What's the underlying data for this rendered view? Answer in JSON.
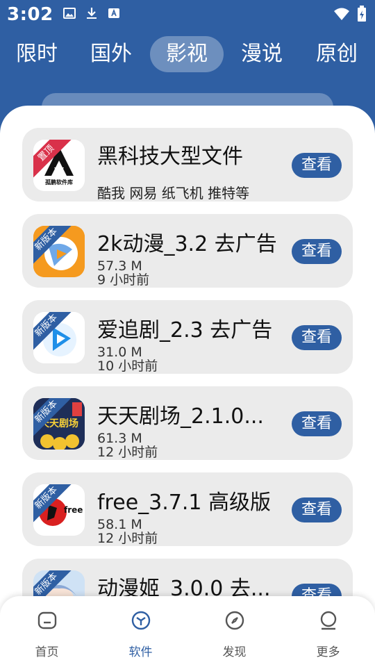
{
  "status_bar": {
    "time": "3:02",
    "icons": [
      "image-icon",
      "download-icon",
      "font-icon",
      "wifi-icon",
      "battery-icon"
    ]
  },
  "tabs": [
    {
      "label": "限时"
    },
    {
      "label": "国外"
    },
    {
      "label": "影视",
      "active": true
    },
    {
      "label": "漫说"
    },
    {
      "label": "原创"
    }
  ],
  "apps": [
    {
      "title": "黑科技大型文件",
      "subtitle": "酷我 网易 纸飞机 推特等",
      "ribbon": "置顶",
      "button": "查看",
      "icon_text": "孤鹏软件库"
    },
    {
      "title": "2k动漫_3.2 去广告",
      "size": "57.3 M",
      "updated": "9 小时前",
      "ribbon": "新版本",
      "button": "查看"
    },
    {
      "title": "爱追剧_2.3 去广告",
      "size": "31.0 M",
      "updated": "10 小时前",
      "ribbon": "新版本",
      "button": "查看"
    },
    {
      "title": "天天剧场_2.1.0...",
      "size": "61.3 M",
      "updated": "12 小时前",
      "ribbon": "新版本",
      "button": "查看",
      "icon_text": "天天剧场"
    },
    {
      "title": "free_3.7.1 高级版",
      "size": "58.1 M",
      "updated": "12 小时前",
      "ribbon": "新版本",
      "button": "查看",
      "icon_text": "free"
    },
    {
      "title": "动漫姬_3.0.0 去...",
      "ribbon": "新版本",
      "button": "查看"
    }
  ],
  "bottom_nav": [
    {
      "label": "首页",
      "icon": "home-icon"
    },
    {
      "label": "软件",
      "icon": "box-icon",
      "active": true
    },
    {
      "label": "发现",
      "icon": "compass-icon"
    },
    {
      "label": "更多",
      "icon": "user-icon"
    }
  ],
  "colors": {
    "primary": "#2f5fa3",
    "ribbon_top": "#d9314a",
    "card_bg": "#ebebeb"
  }
}
